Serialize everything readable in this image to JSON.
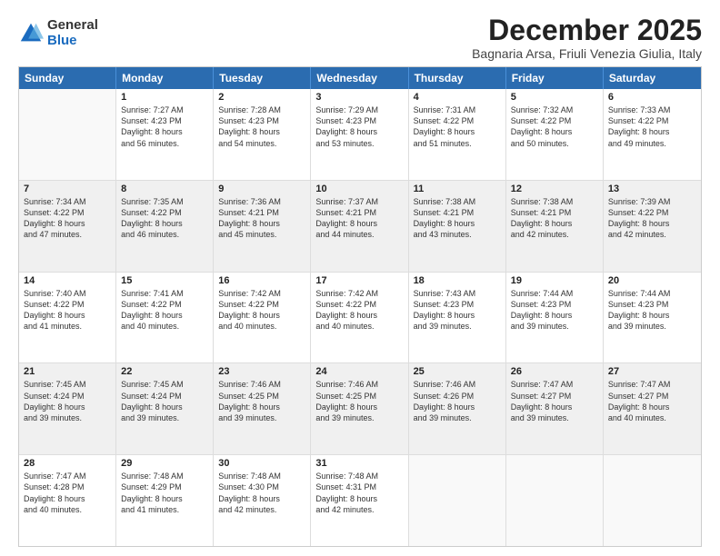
{
  "logo": {
    "general": "General",
    "blue": "Blue"
  },
  "title": "December 2025",
  "subtitle": "Bagnaria Arsa, Friuli Venezia Giulia, Italy",
  "days": [
    "Sunday",
    "Monday",
    "Tuesday",
    "Wednesday",
    "Thursday",
    "Friday",
    "Saturday"
  ],
  "rows": [
    [
      {
        "day": "",
        "lines": [],
        "empty": true
      },
      {
        "day": "1",
        "lines": [
          "Sunrise: 7:27 AM",
          "Sunset: 4:23 PM",
          "Daylight: 8 hours",
          "and 56 minutes."
        ]
      },
      {
        "day": "2",
        "lines": [
          "Sunrise: 7:28 AM",
          "Sunset: 4:23 PM",
          "Daylight: 8 hours",
          "and 54 minutes."
        ]
      },
      {
        "day": "3",
        "lines": [
          "Sunrise: 7:29 AM",
          "Sunset: 4:23 PM",
          "Daylight: 8 hours",
          "and 53 minutes."
        ]
      },
      {
        "day": "4",
        "lines": [
          "Sunrise: 7:31 AM",
          "Sunset: 4:22 PM",
          "Daylight: 8 hours",
          "and 51 minutes."
        ]
      },
      {
        "day": "5",
        "lines": [
          "Sunrise: 7:32 AM",
          "Sunset: 4:22 PM",
          "Daylight: 8 hours",
          "and 50 minutes."
        ]
      },
      {
        "day": "6",
        "lines": [
          "Sunrise: 7:33 AM",
          "Sunset: 4:22 PM",
          "Daylight: 8 hours",
          "and 49 minutes."
        ]
      }
    ],
    [
      {
        "day": "7",
        "lines": [
          "Sunrise: 7:34 AM",
          "Sunset: 4:22 PM",
          "Daylight: 8 hours",
          "and 47 minutes."
        ],
        "shaded": true
      },
      {
        "day": "8",
        "lines": [
          "Sunrise: 7:35 AM",
          "Sunset: 4:22 PM",
          "Daylight: 8 hours",
          "and 46 minutes."
        ],
        "shaded": true
      },
      {
        "day": "9",
        "lines": [
          "Sunrise: 7:36 AM",
          "Sunset: 4:21 PM",
          "Daylight: 8 hours",
          "and 45 minutes."
        ],
        "shaded": true
      },
      {
        "day": "10",
        "lines": [
          "Sunrise: 7:37 AM",
          "Sunset: 4:21 PM",
          "Daylight: 8 hours",
          "and 44 minutes."
        ],
        "shaded": true
      },
      {
        "day": "11",
        "lines": [
          "Sunrise: 7:38 AM",
          "Sunset: 4:21 PM",
          "Daylight: 8 hours",
          "and 43 minutes."
        ],
        "shaded": true
      },
      {
        "day": "12",
        "lines": [
          "Sunrise: 7:38 AM",
          "Sunset: 4:21 PM",
          "Daylight: 8 hours",
          "and 42 minutes."
        ],
        "shaded": true
      },
      {
        "day": "13",
        "lines": [
          "Sunrise: 7:39 AM",
          "Sunset: 4:22 PM",
          "Daylight: 8 hours",
          "and 42 minutes."
        ],
        "shaded": true
      }
    ],
    [
      {
        "day": "14",
        "lines": [
          "Sunrise: 7:40 AM",
          "Sunset: 4:22 PM",
          "Daylight: 8 hours",
          "and 41 minutes."
        ]
      },
      {
        "day": "15",
        "lines": [
          "Sunrise: 7:41 AM",
          "Sunset: 4:22 PM",
          "Daylight: 8 hours",
          "and 40 minutes."
        ]
      },
      {
        "day": "16",
        "lines": [
          "Sunrise: 7:42 AM",
          "Sunset: 4:22 PM",
          "Daylight: 8 hours",
          "and 40 minutes."
        ]
      },
      {
        "day": "17",
        "lines": [
          "Sunrise: 7:42 AM",
          "Sunset: 4:22 PM",
          "Daylight: 8 hours",
          "and 40 minutes."
        ]
      },
      {
        "day": "18",
        "lines": [
          "Sunrise: 7:43 AM",
          "Sunset: 4:23 PM",
          "Daylight: 8 hours",
          "and 39 minutes."
        ]
      },
      {
        "day": "19",
        "lines": [
          "Sunrise: 7:44 AM",
          "Sunset: 4:23 PM",
          "Daylight: 8 hours",
          "and 39 minutes."
        ]
      },
      {
        "day": "20",
        "lines": [
          "Sunrise: 7:44 AM",
          "Sunset: 4:23 PM",
          "Daylight: 8 hours",
          "and 39 minutes."
        ]
      }
    ],
    [
      {
        "day": "21",
        "lines": [
          "Sunrise: 7:45 AM",
          "Sunset: 4:24 PM",
          "Daylight: 8 hours",
          "and 39 minutes."
        ],
        "shaded": true
      },
      {
        "day": "22",
        "lines": [
          "Sunrise: 7:45 AM",
          "Sunset: 4:24 PM",
          "Daylight: 8 hours",
          "and 39 minutes."
        ],
        "shaded": true
      },
      {
        "day": "23",
        "lines": [
          "Sunrise: 7:46 AM",
          "Sunset: 4:25 PM",
          "Daylight: 8 hours",
          "and 39 minutes."
        ],
        "shaded": true
      },
      {
        "day": "24",
        "lines": [
          "Sunrise: 7:46 AM",
          "Sunset: 4:25 PM",
          "Daylight: 8 hours",
          "and 39 minutes."
        ],
        "shaded": true
      },
      {
        "day": "25",
        "lines": [
          "Sunrise: 7:46 AM",
          "Sunset: 4:26 PM",
          "Daylight: 8 hours",
          "and 39 minutes."
        ],
        "shaded": true
      },
      {
        "day": "26",
        "lines": [
          "Sunrise: 7:47 AM",
          "Sunset: 4:27 PM",
          "Daylight: 8 hours",
          "and 39 minutes."
        ],
        "shaded": true
      },
      {
        "day": "27",
        "lines": [
          "Sunrise: 7:47 AM",
          "Sunset: 4:27 PM",
          "Daylight: 8 hours",
          "and 40 minutes."
        ],
        "shaded": true
      }
    ],
    [
      {
        "day": "28",
        "lines": [
          "Sunrise: 7:47 AM",
          "Sunset: 4:28 PM",
          "Daylight: 8 hours",
          "and 40 minutes."
        ]
      },
      {
        "day": "29",
        "lines": [
          "Sunrise: 7:48 AM",
          "Sunset: 4:29 PM",
          "Daylight: 8 hours",
          "and 41 minutes."
        ]
      },
      {
        "day": "30",
        "lines": [
          "Sunrise: 7:48 AM",
          "Sunset: 4:30 PM",
          "Daylight: 8 hours",
          "and 42 minutes."
        ]
      },
      {
        "day": "31",
        "lines": [
          "Sunrise: 7:48 AM",
          "Sunset: 4:31 PM",
          "Daylight: 8 hours",
          "and 42 minutes."
        ]
      },
      {
        "day": "",
        "lines": [],
        "empty": true
      },
      {
        "day": "",
        "lines": [],
        "empty": true
      },
      {
        "day": "",
        "lines": [],
        "empty": true
      }
    ]
  ]
}
